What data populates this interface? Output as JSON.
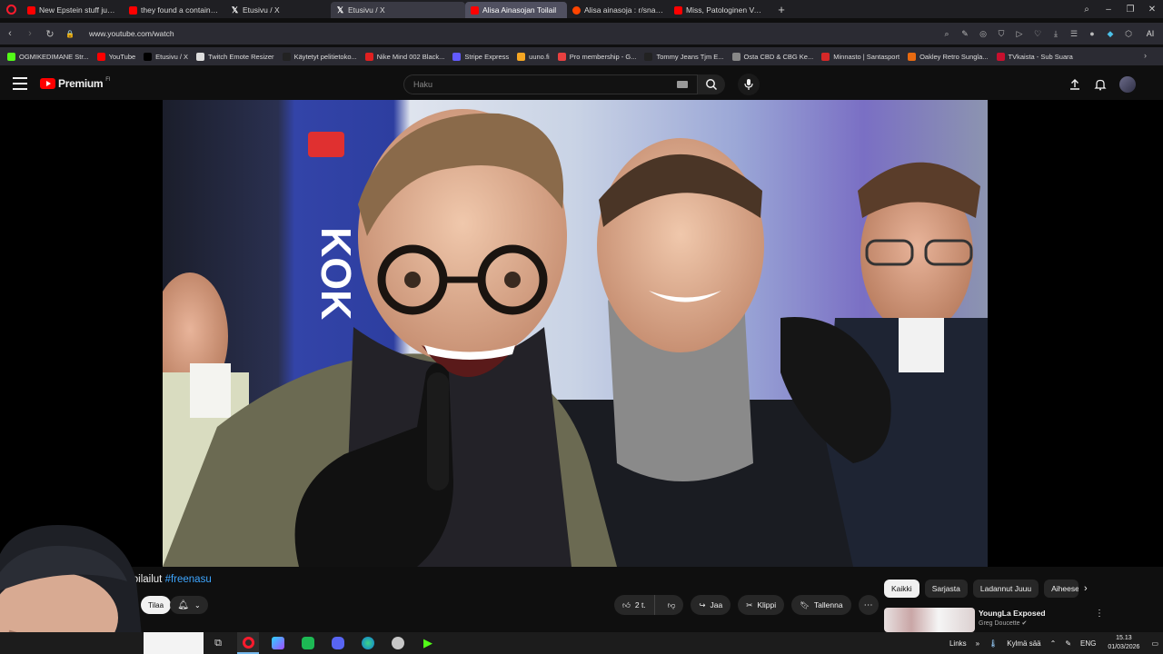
{
  "browser": {
    "tabs": [
      {
        "label": "New Epstein stuff just dro",
        "favicon": "youtube-icon"
      },
      {
        "label": "they found a container fill",
        "favicon": "youtube-icon"
      },
      {
        "label": "Etusivu / X",
        "favicon": "x-icon"
      },
      {
        "label": "Etusivu / X",
        "favicon": "x-icon"
      },
      {
        "label": "Alisa Ainasojan Toilail",
        "favicon": "youtube-icon"
      },
      {
        "label": "Alisa ainasoja : r/snappis",
        "favicon": "reddit-icon"
      },
      {
        "label": "Miss, Patologinen Valehte",
        "favicon": "youtube-icon"
      }
    ],
    "url": "www.youtube.com/watch",
    "ai_label": "AI",
    "bookmarks": [
      {
        "label": "OGMIKEDIMANE Str...",
        "color": "#53fc18"
      },
      {
        "label": "YouTube",
        "color": "#ff0000"
      },
      {
        "label": "Etusivu / X",
        "color": "#000000"
      },
      {
        "label": "Twitch Emote Resizer",
        "color": "#dddddd"
      },
      {
        "label": "Käytetyt pelitietoko...",
        "color": "#222222"
      },
      {
        "label": "Nike Mind 002 Black...",
        "color": "#e02020"
      },
      {
        "label": "Stripe Express",
        "color": "#635bff"
      },
      {
        "label": "uuno.fi",
        "color": "#f5a623"
      },
      {
        "label": "Pro membership - G...",
        "color": "#e84040"
      },
      {
        "label": "Tommy Jeans Tjm E...",
        "color": "#222222"
      },
      {
        "label": "Osta CBD & CBG Ke...",
        "color": "#888888"
      },
      {
        "label": "Minnasto | Santasport",
        "color": "#d62828"
      },
      {
        "label": "Oakley Retro Sungla...",
        "color": "#e86a10"
      },
      {
        "label": "TVkaista - Sub Suara",
        "color": "#c8102e"
      }
    ]
  },
  "youtube": {
    "brand": "Premium",
    "country": "FI",
    "search_placeholder": "Haku",
    "video": {
      "title_prefix": "Toilailut",
      "hashtag": "#freenasu",
      "subscribe_label": "Tilaa",
      "likes": "2 t.",
      "share_label": "Jaa",
      "clip_label": "Klippi",
      "save_label": "Tallenna"
    },
    "chips": [
      "Kaikki",
      "Sarjasta",
      "Ladannut Juuu",
      "Aiheesee"
    ],
    "recommendation": {
      "title": "YoungLa Exposed",
      "channel": "Greg Doucette"
    }
  },
  "taskbar": {
    "links_label": "Links",
    "weather": "Kylmä sää",
    "language": "ENG",
    "time": "15.13",
    "date": "01/03/2026"
  },
  "colors": {
    "youtube_red": "#ff0000",
    "link_blue": "#3ea6ff",
    "page_bg": "#0f0f0f"
  }
}
